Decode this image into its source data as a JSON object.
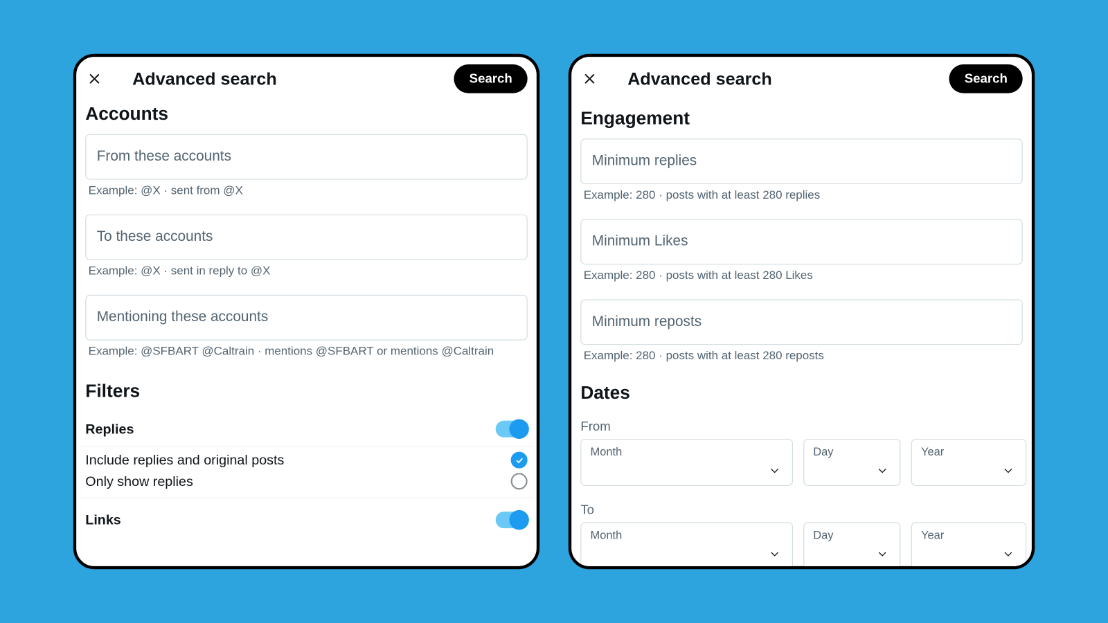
{
  "header": {
    "title": "Advanced search",
    "search_label": "Search"
  },
  "accounts": {
    "section_title": "Accounts",
    "from": {
      "placeholder": "From these accounts",
      "hint": "Example: @X · sent from @X"
    },
    "to": {
      "placeholder": "To these accounts",
      "hint": "Example: @X · sent in reply to @X"
    },
    "mentioning": {
      "placeholder": "Mentioning these accounts",
      "hint": "Example: @SFBART @Caltrain · mentions @SFBART or mentions @Caltrain"
    }
  },
  "filters": {
    "section_title": "Filters",
    "replies_label": "Replies",
    "option_include": "Include replies and original posts",
    "option_only": "Only show replies",
    "links_label": "Links"
  },
  "engagement": {
    "section_title": "Engagement",
    "min_replies": {
      "placeholder": "Minimum replies",
      "hint": "Example: 280 · posts with at least 280 replies"
    },
    "min_likes": {
      "placeholder": "Minimum Likes",
      "hint": "Example: 280 · posts with at least 280 Likes"
    },
    "min_reposts": {
      "placeholder": "Minimum reposts",
      "hint": "Example: 280 · posts with at least 280 reposts"
    }
  },
  "dates": {
    "section_title": "Dates",
    "from_label": "From",
    "to_label": "To",
    "month": "Month",
    "day": "Day",
    "year": "Year"
  }
}
